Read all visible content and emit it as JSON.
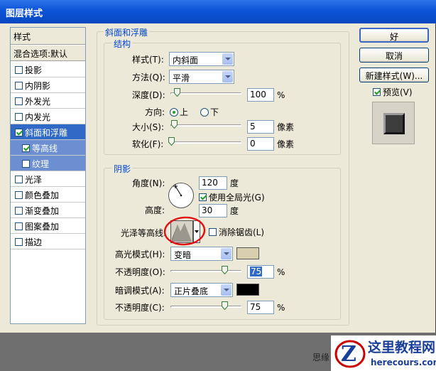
{
  "window": {
    "title": "图层样式"
  },
  "styles_panel": {
    "header": "样式",
    "blend_options": "混合选项:默认",
    "items": [
      {
        "label": "投影",
        "checked": false
      },
      {
        "label": "内阴影",
        "checked": false
      },
      {
        "label": "外发光",
        "checked": false
      },
      {
        "label": "内发光",
        "checked": false
      },
      {
        "label": "斜面和浮雕",
        "checked": true,
        "selected": true
      },
      {
        "label": "等高线",
        "checked": true,
        "sub": true
      },
      {
        "label": "纹理",
        "checked": false,
        "sub": true
      },
      {
        "label": "光泽",
        "checked": false
      },
      {
        "label": "颜色叠加",
        "checked": false
      },
      {
        "label": "渐变叠加",
        "checked": false
      },
      {
        "label": "图案叠加",
        "checked": false
      },
      {
        "label": "描边",
        "checked": false
      }
    ]
  },
  "bevel": {
    "group_title": "斜面和浮雕",
    "structure": {
      "title": "结构",
      "style_label": "样式(T):",
      "style_value": "内斜面",
      "technique_label": "方法(Q):",
      "technique_value": "平滑",
      "depth_label": "深度(D):",
      "depth_value": "100",
      "depth_unit": "%",
      "direction_label": "方向:",
      "direction_up": "上",
      "direction_down": "下",
      "size_label": "大小(S):",
      "size_value": "5",
      "size_unit": "像素",
      "soften_label": "软化(F):",
      "soften_value": "0",
      "soften_unit": "像素"
    },
    "shading": {
      "title": "阴影",
      "angle_label": "角度(N):",
      "angle_value": "120",
      "angle_unit": "度",
      "global_light_label": "使用全局光(G)",
      "altitude_label": "高度:",
      "altitude_value": "30",
      "altitude_unit": "度",
      "gloss_contour_label": "光泽等高线:",
      "anti_aliased_label": "消除锯齿(L)",
      "highlight_mode_label": "高光模式(H):",
      "highlight_mode_value": "变暗",
      "highlight_color": "#d8cfae",
      "highlight_opacity_label": "不透明度(O):",
      "highlight_opacity_value": "75",
      "shadow_mode_label": "暗调模式(A):",
      "shadow_mode_value": "正片叠底",
      "shadow_color": "#000000",
      "shadow_opacity_label": "不透明度(C):",
      "shadow_opacity_value": "75",
      "opacity_unit": "%"
    }
  },
  "buttons": {
    "ok": "好",
    "cancel": "取消",
    "new_style": "新建样式(W)...",
    "preview": "预览(V)"
  },
  "watermark": {
    "site_name": "这里教程网",
    "site_url": "herecours.com",
    "cut_text": "思缘"
  },
  "colors": {
    "title_bar": "#0c54d8",
    "selection": "#3169c6",
    "annotation": "#e01010"
  }
}
